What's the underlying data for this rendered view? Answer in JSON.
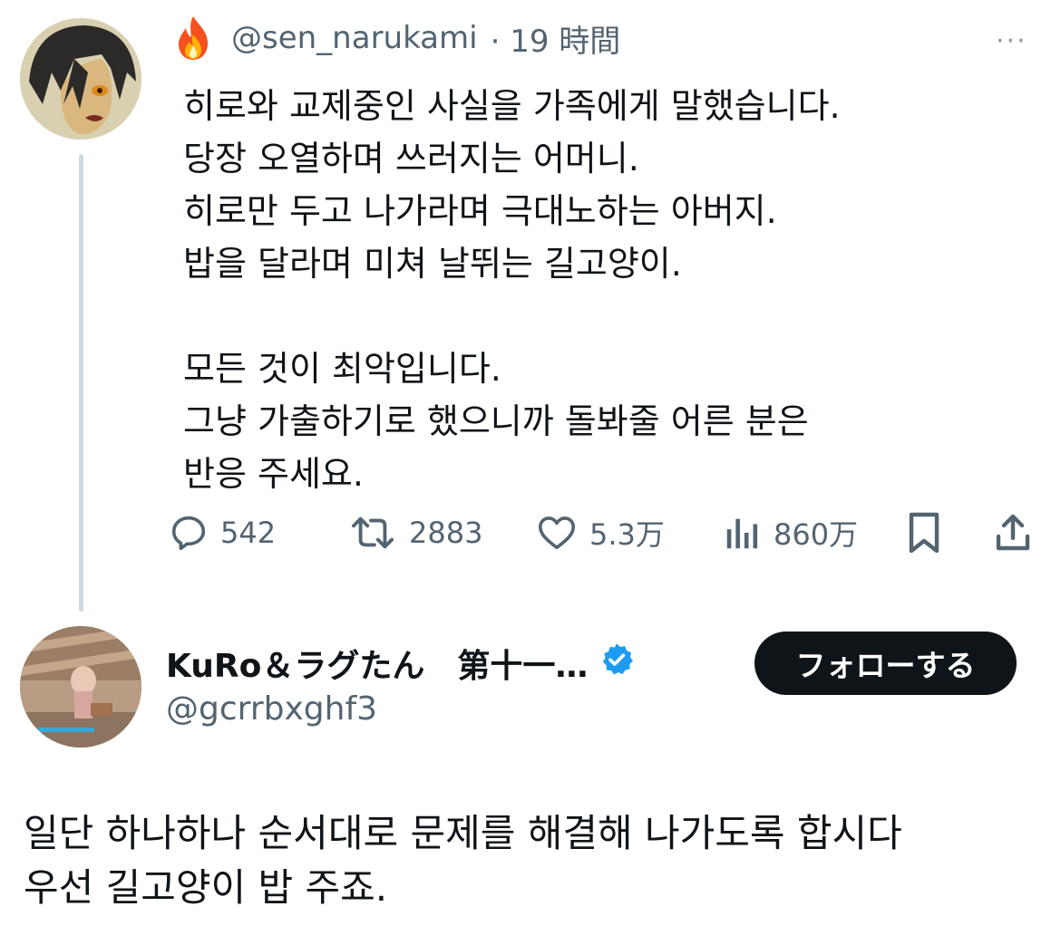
{
  "tweet": {
    "handle": "@sen_narukami",
    "time": "· 19 時間",
    "more": "···",
    "lines": [
      "히로와 교제중인 사실을 가족에게 말했습니다.",
      "당장 오열하며 쓰러지는 어머니.",
      "히로만 두고 나가라며 극대노하는 아버지.",
      "밥을 달라며 미쳐 날뛰는 길고양이.",
      "",
      "모든 것이 최악입니다.",
      "그냥 가출하기로 했으니까 돌봐줄 어른 분은",
      "반응 주세요."
    ],
    "actions": {
      "replies": "542",
      "reposts": "2883",
      "likes": "5.3万",
      "views": "860万"
    }
  },
  "reply": {
    "name": "KuRo＆ラグたん　第十一…",
    "handle": "@gcrrbxghf3",
    "follow_label": "フォローする",
    "lines": [
      "일단 하나하나 순서대로 문제를 해결해 나가도록 합시다",
      "우선 길고양이 밥 주죠."
    ]
  },
  "colors": {
    "text": "#0f1419",
    "secondary": "#536471",
    "verified": "#1d9bf0",
    "button_bg": "#0f1419"
  }
}
